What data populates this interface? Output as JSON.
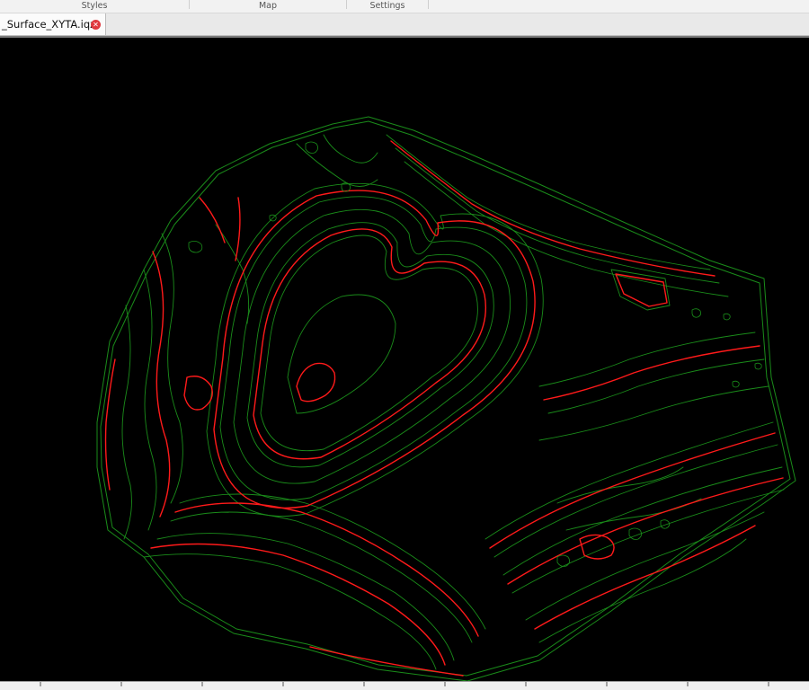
{
  "ribbon": {
    "groups": [
      {
        "label": "Styles"
      },
      {
        "label": "Map"
      },
      {
        "label": "Settings"
      }
    ]
  },
  "document_tab": {
    "title": "_Surface_XYTA.iqz",
    "close_icon": "close-icon"
  },
  "map": {
    "background": "#000000",
    "major_contour_color": "#ff0000",
    "minor_contour_color": "#1a8c1a"
  },
  "ruler": {
    "tick_labels_visible": false
  }
}
